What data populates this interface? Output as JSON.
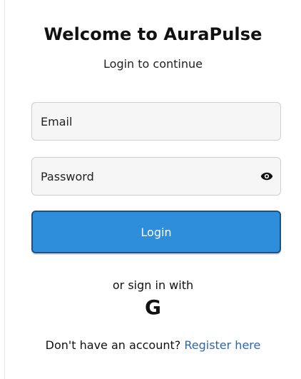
{
  "header": {
    "title": "Welcome to AuraPulse",
    "subtitle": "Login to continue"
  },
  "form": {
    "email_placeholder": "Email",
    "password_placeholder": "Password",
    "login_label": "Login"
  },
  "social": {
    "text": "or sign in with",
    "google_icon_text": "G"
  },
  "register": {
    "prompt": "Don't have an account?",
    "link_text": "Register here"
  },
  "colors": {
    "primary": "#2f8edb",
    "link": "#2f66ab"
  }
}
